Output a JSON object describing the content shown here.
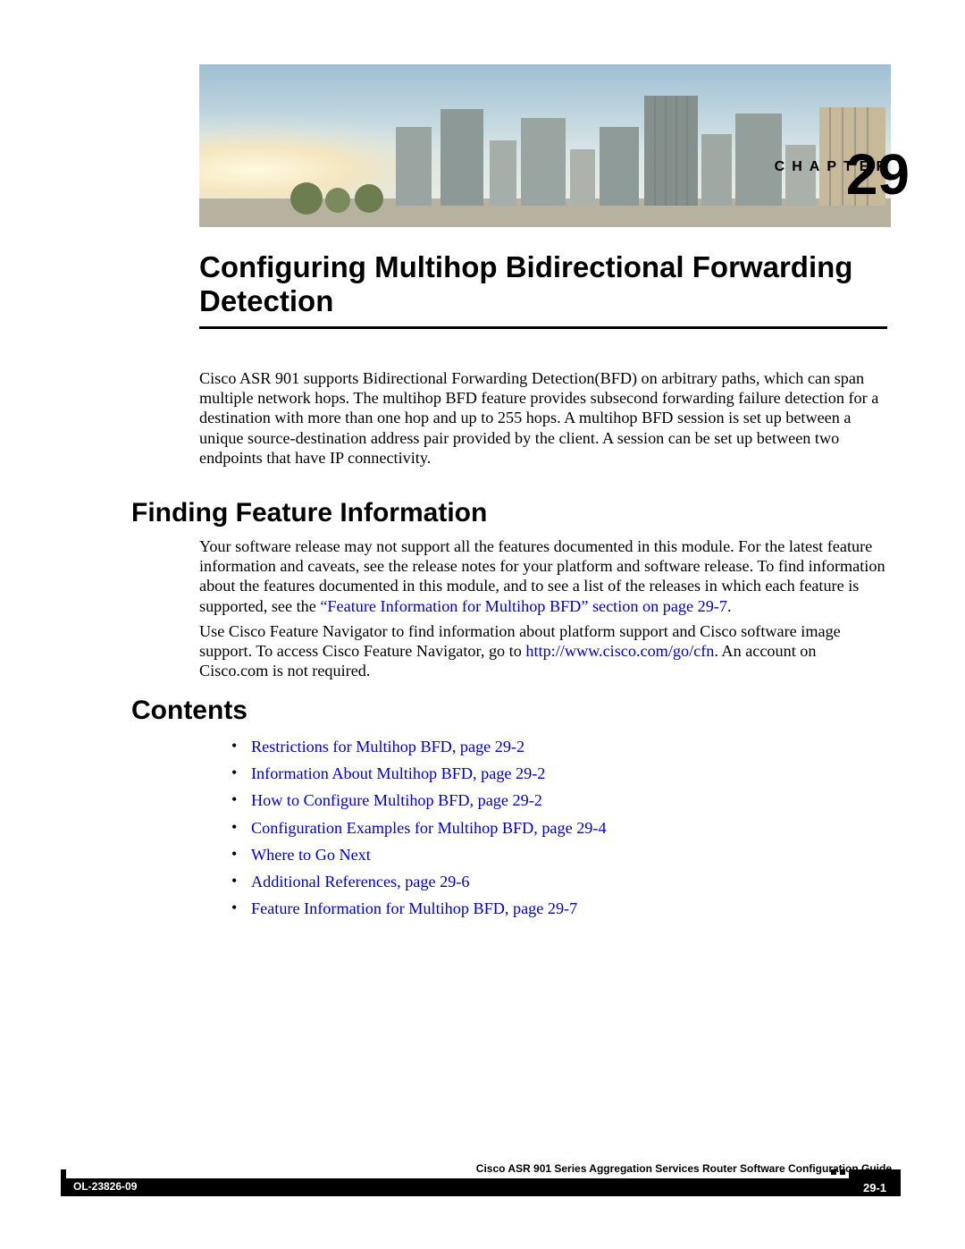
{
  "chapter": {
    "label": "CHAPTER",
    "number": "29",
    "title": "Configuring Multihop Bidirectional Forwarding Detection"
  },
  "intro": "Cisco ASR 901 supports Bidirectional Forwarding Detection(BFD) on arbitrary paths, which can span multiple network hops. The multihop BFD feature provides subsecond forwarding failure detection for a destination with more than one hop and up to 255 hops. A multihop BFD session is set up between a unique source-destination address pair provided by the client. A session can be set up between two endpoints that have IP connectivity.",
  "sections": {
    "finding": {
      "heading": "Finding Feature Information",
      "p1_pre": "Your software release may not support all the features documented in this module. For the latest feature information and caveats, see the release notes for your platform and software release. To find information about the features documented in this module, and to see a list of the releases in which each feature is supported, see the ",
      "p1_link": "“Feature Information for Multihop BFD” section on page 29-7",
      "p1_post": ".",
      "p2_pre": "Use Cisco Feature Navigator to find information about platform support and Cisco software image support. To access Cisco Feature Navigator, go to ",
      "p2_link": "http://www.cisco.com/go/cfn",
      "p2_post": ". An account on Cisco.com is not required."
    },
    "contents": {
      "heading": "Contents",
      "items": [
        "Restrictions for Multihop BFD, page 29-2",
        "Information About Multihop BFD, page 29-2",
        "How to Configure Multihop BFD, page 29-2",
        "Configuration Examples for Multihop BFD, page 29-4",
        "Where to Go Next",
        "Additional References, page 29-6",
        "Feature Information for Multihop BFD, page 29-7"
      ]
    }
  },
  "footer": {
    "guide": "Cisco ASR 901 Series Aggregation Services Router Software Configuration Guide",
    "doc": "OL-23826-09",
    "page": "29-1"
  }
}
